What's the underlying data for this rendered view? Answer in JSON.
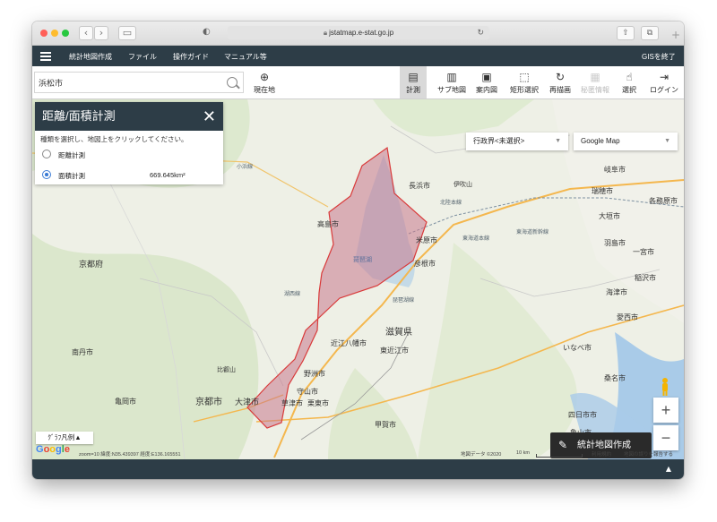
{
  "browser": {
    "url": "jstatmap.e-stat.go.jp"
  },
  "topnav": {
    "items": [
      "統計地図作成",
      "ファイル",
      "操作ガイド",
      "マニュアル等"
    ],
    "exit": "GISを終了"
  },
  "toolbar": {
    "search_value": "浜松市",
    "current_location": "現在地",
    "tools": [
      {
        "label": "計測",
        "icon": "ruler-icon",
        "active": true
      },
      {
        "label": "サブ地図",
        "icon": "map-icon"
      },
      {
        "label": "案内図",
        "icon": "overview-icon"
      },
      {
        "label": "矩形選択",
        "icon": "rect-select-icon"
      },
      {
        "label": "再描画",
        "icon": "redraw-icon"
      },
      {
        "label": "秘匿情報",
        "icon": "secret-icon",
        "disabled": true
      },
      {
        "label": "選択",
        "icon": "pointer-icon"
      },
      {
        "label": "ログイン",
        "icon": "login-icon"
      }
    ]
  },
  "measure_panel": {
    "title": "距離/面積計測",
    "description": "種類を選択し、地図上をクリックしてください。",
    "options": [
      {
        "label": "距離計測",
        "selected": false
      },
      {
        "label": "面積計測",
        "selected": true
      }
    ],
    "area_result": "669.645km²"
  },
  "map": {
    "admin_select": "行政界<未選択>",
    "basemap_select": "Google Map",
    "cta": "統計地図作成",
    "legend": "ｸﾞﾗﾌ凡例▲",
    "google_logo": "Google",
    "status": "zoom=10  緯度:N35.439397  経度:E136.165551",
    "attribution": "地図データ ©2020",
    "scale": "10 km",
    "terms": "利用規約",
    "report": "地図の誤りを報告する",
    "zoom_in": "+",
    "zoom_out": "−",
    "polygon_color": "#c9788c",
    "labels": [
      {
        "text": "長浜市",
        "size": 8
      },
      {
        "text": "伊吹山",
        "size": 7
      },
      {
        "text": "高島市",
        "size": 8
      },
      {
        "text": "米原市",
        "size": 8
      },
      {
        "text": "彦根市",
        "size": 8
      },
      {
        "text": "琵琶湖",
        "size": 7
      },
      {
        "text": "滋賀県",
        "size": 10
      },
      {
        "text": "近江八幡市",
        "size": 8
      },
      {
        "text": "東近江市",
        "size": 8
      },
      {
        "text": "野洲市",
        "size": 8
      },
      {
        "text": "守山市",
        "size": 8
      },
      {
        "text": "草津市",
        "size": 8
      },
      {
        "text": "栗東市",
        "size": 8
      },
      {
        "text": "大津市",
        "size": 9
      },
      {
        "text": "京都市",
        "size": 10
      },
      {
        "text": "京都府",
        "size": 9
      },
      {
        "text": "南丹市",
        "size": 8
      },
      {
        "text": "亀岡市",
        "size": 8
      },
      {
        "text": "比叡山",
        "size": 7
      },
      {
        "text": "甲賀市",
        "size": 8
      },
      {
        "text": "本巣市",
        "size": 8
      },
      {
        "text": "岐阜市",
        "size": 8
      },
      {
        "text": "瑞穂市",
        "size": 8
      },
      {
        "text": "大垣市",
        "size": 8
      },
      {
        "text": "各務原市",
        "size": 8
      },
      {
        "text": "羽島市",
        "size": 8
      },
      {
        "text": "一宮市",
        "size": 8
      },
      {
        "text": "稲沢市",
        "size": 8
      },
      {
        "text": "海津市",
        "size": 8
      },
      {
        "text": "愛西市",
        "size": 8
      },
      {
        "text": "いなべ市",
        "size": 8
      },
      {
        "text": "桑名市",
        "size": 8
      },
      {
        "text": "四日市市",
        "size": 8
      },
      {
        "text": "亀山市",
        "size": 8
      },
      {
        "text": "鈴鹿市",
        "size": 8
      },
      {
        "text": "小浜線",
        "size": 6
      },
      {
        "text": "湖西線",
        "size": 6
      },
      {
        "text": "琵琶湖線",
        "size": 6
      },
      {
        "text": "東海道新幹線",
        "size": 6
      },
      {
        "text": "東海道本線",
        "size": 6
      },
      {
        "text": "北陸本線",
        "size": 6
      }
    ]
  }
}
